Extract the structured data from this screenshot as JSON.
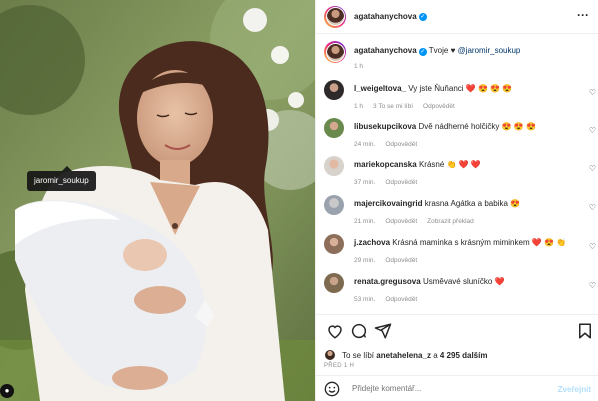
{
  "photo": {
    "tag_label": "jaromir_soukup"
  },
  "header": {
    "username": "agatahanychova"
  },
  "caption": {
    "username": "agatahanychova",
    "text": "Tvoje",
    "heart": "♥",
    "mention": "@jaromir_soukup",
    "time": "1 h"
  },
  "comments": [
    {
      "username": "l_weigeltova_",
      "text": "Vy jste Ňuňanci",
      "emoji": "❤️ 😍 😍 😍",
      "time": "1 h",
      "likes": "3 To se mi líbí",
      "reply": "Odpovědět",
      "extra": ""
    },
    {
      "username": "libusekupcikova",
      "text": "Dvě nádherné holčičky",
      "emoji": "😍 😍 😍",
      "time": "24 min.",
      "likes": "",
      "reply": "Odpovědět",
      "extra": ""
    },
    {
      "username": "mariekopcanska",
      "text": "Krásné",
      "emoji": "👏 ❤️ ❤️",
      "time": "37 min.",
      "likes": "",
      "reply": "Odpovědět",
      "extra": ""
    },
    {
      "username": "majercikovaingrid",
      "text": "krasna Agátka a babika",
      "emoji": "😍",
      "time": "21 min.",
      "likes": "",
      "reply": "Odpovědět",
      "extra": "Zobrazit překlad"
    },
    {
      "username": "j.zachova",
      "text": "Krásná maminka s krásným miminkem",
      "emoji": "❤️ 😍 👏",
      "time": "29 min.",
      "likes": "",
      "reply": "Odpovědět",
      "extra": ""
    },
    {
      "username": "renata.gregusova",
      "text": "Usměvavé sluníčko",
      "emoji": "❤️",
      "time": "53 min.",
      "likes": "",
      "reply": "Odpovědět",
      "extra": ""
    }
  ],
  "likes": {
    "prefix": "To se líbí",
    "user": "anetahelena_z",
    "middle": "a",
    "count": "4 295 dalším"
  },
  "post_time": "PŘED 1 H",
  "comment_bar": {
    "placeholder": "Přidejte komentář...",
    "post_label": "Zveřejnit"
  },
  "colors": {
    "accent": "#0095f6",
    "mention": "#00376b",
    "muted": "#8e8e8e",
    "post_disabled": "#b2dffc"
  },
  "icons": [
    "more-icon",
    "heart-icon",
    "comment-icon",
    "share-icon",
    "bookmark-icon",
    "emoji-icon",
    "verified-icon",
    "user-tag-icon"
  ]
}
